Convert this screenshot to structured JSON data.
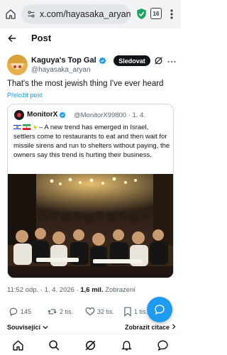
{
  "browser": {
    "url": "x.com/hayasaka_aryan/st",
    "tab_count": "16"
  },
  "header": {
    "title": "Post"
  },
  "post": {
    "display_name": "Kaguya's Top Gal",
    "handle": "@hayasaka_aryan",
    "follow_label": "Sledovat",
    "text": "That's the most jewish thing I've ever heard",
    "translate_label": "Přeložit post",
    "time": "11:52 odp.",
    "date": "1. 4. 2026",
    "views": "1,6 mil.",
    "views_label": "Zobrazení"
  },
  "quote": {
    "display_name": "MonitorX",
    "handle": "@MonitorX99800",
    "date": "· 1. 4.",
    "text": "– A new trend has emerged in Israel, settlers come to restaurants to eat and then wait for missile sirens and run to shelters without paying, the owners say this trend is hurting their business."
  },
  "actions": {
    "replies": "145",
    "reposts": "2 tis.",
    "likes": "32 tis.",
    "bookmarks": "1 tis."
  },
  "footer": {
    "related": "Související",
    "show_quotes": "Zobrazit citace"
  },
  "colors": {
    "accent": "#1d9bf0",
    "text": "#0f1419",
    "muted": "#536471",
    "verified": "#1d9bf0"
  }
}
